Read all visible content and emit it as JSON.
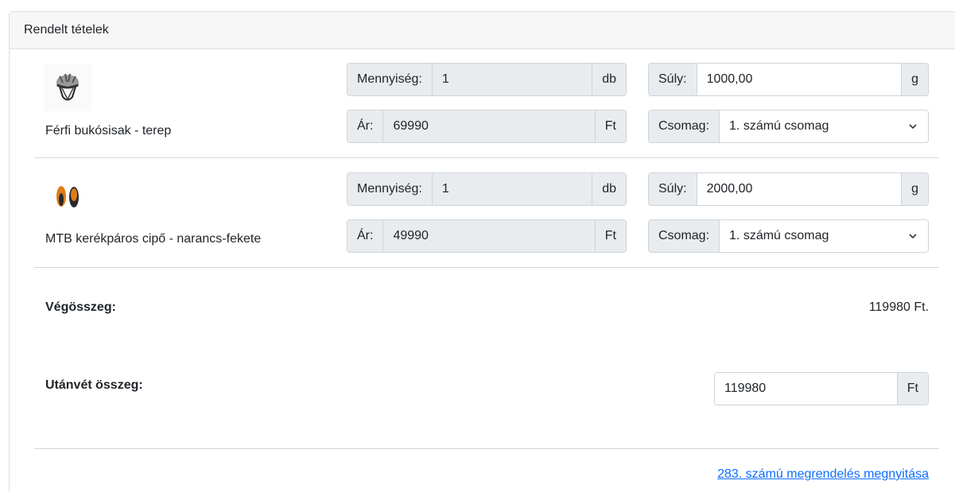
{
  "card": {
    "header": "Rendelt tételek"
  },
  "items": [
    {
      "name": "Férfi bukósisak - terep",
      "image_icon": "helmet-icon",
      "quantity_label": "Mennyiség:",
      "quantity_value": "1",
      "quantity_unit": "db",
      "price_label": "Ár:",
      "price_value": "69990",
      "price_unit": "Ft",
      "weight_label": "Súly:",
      "weight_value": "1000,00",
      "weight_unit": "g",
      "package_label": "Csomag:",
      "package_value": "1. számú csomag"
    },
    {
      "name": "MTB kerékpáros cipő - narancs-fekete",
      "image_icon": "shoes-icon",
      "quantity_label": "Mennyiség:",
      "quantity_value": "1",
      "quantity_unit": "db",
      "price_label": "Ár:",
      "price_value": "49990",
      "price_unit": "Ft",
      "weight_label": "Súly:",
      "weight_value": "2000,00",
      "weight_unit": "g",
      "package_label": "Csomag:",
      "package_value": "1. számú csomag"
    }
  ],
  "summary": {
    "total_label": "Végösszeg:",
    "total_value": "119980 Ft.",
    "cod_label": "Utánvét összeg:",
    "cod_value": "119980",
    "cod_unit": "Ft"
  },
  "footer": {
    "open_order_link": "283. számú megrendelés megnyitása"
  },
  "colors": {
    "addon_bg": "#e9ecef",
    "border": "#ced4da",
    "link": "#0d6efd",
    "header_bg": "#f7f7f7"
  }
}
